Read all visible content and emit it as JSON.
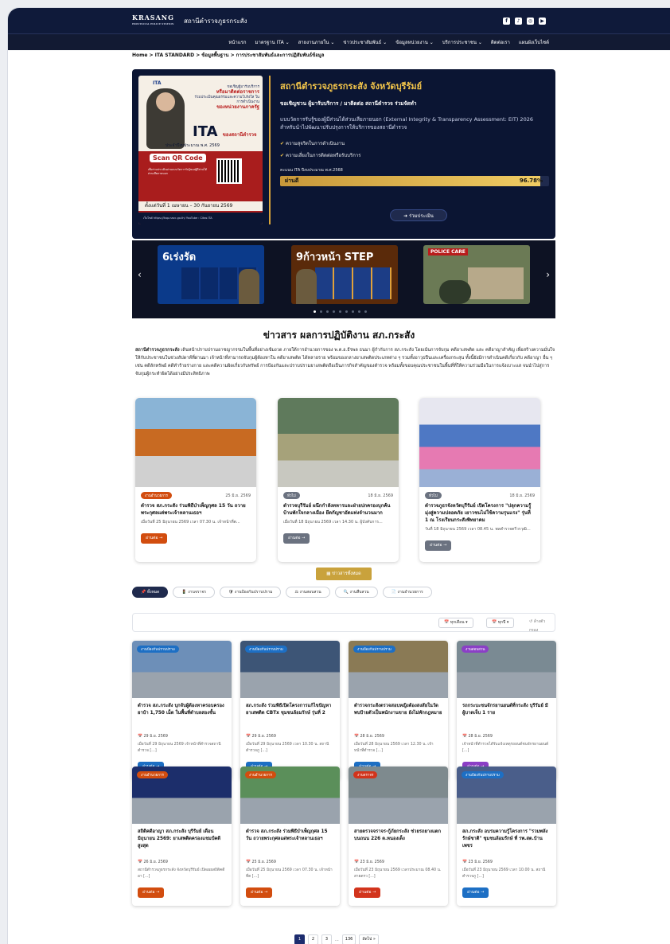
{
  "header": {
    "logo_text": "KRASANG",
    "logo_sub": "PROVINCIAL POLICE STATION",
    "station_name": "สถานีตำรวจภูธรกระสัง",
    "social_icons": [
      "facebook-icon",
      "tiktok-icon",
      "instagram-icon",
      "youtube-icon"
    ]
  },
  "nav": {
    "items": [
      "หน้าแรก",
      "มาตรฐาน ITA ⌄",
      "สายงานภายใน ⌄",
      "ข่าวประชาสัมพันธ์ ⌄",
      "ข้อมูลหน่วยงาน ⌄",
      "บริการประชาชน ⌄",
      "ติดต่อเรา",
      "แผนผังเว็บไซต์"
    ]
  },
  "breadcrumb": "Home > ITA STANDARD > ข้อมูลพื้นฐาน > การประชาสัมพันธ์และการปฏิสัมพันธ์ข้อมูล",
  "hero": {
    "poster": {
      "ita_tag": "ITA",
      "line1": "ขอเชิญผู้มารับบริการ",
      "line2": "หรือมาติดต่อราชการ",
      "line3": "ร่วมประเมินคุณธรรมและความโปร่งใส ในการดำเนินงาน",
      "line4": "ของหน่วยงานภาครัฐ",
      "ita_big": "ITA",
      "ita_of": "ของสถานีตำรวจ",
      "year": "ประจำปีงบประมาณ พ.ศ. 2569",
      "scan": "Scan QR Code",
      "qr_text": "เพื่อร่วมประเมินผ่านแบบวัดการรับรู้ของผู้มีส่วนได้ส่วนเสียภายนอก",
      "dates": "ตั้งแต่วันที่ 1 เมษายน – 30 กันยายน 2569",
      "footer": "เว็บไซต์ https://itap.nacc.go.th/     YouTube : Citas ITA"
    },
    "title": "สถานีตำรวจภูธรกระสัง จังหวัดบุรีรัมย์",
    "subtitle": "ขอเชิญชวน ผู้มารับบริการ / มาติดต่อ สถานีตำรวจ ร่วมจัดทำ",
    "description": "แบบวัดการรับรู้ของผู้มีส่วนได้ส่วนเสียภายนอก (External Integrity & Transparency Assessment: EIT) 2026 สำหรับนำไปพัฒนาปรับปรุงการให้บริการของสถานีตำรวจ",
    "checks": [
      "ความสุจริตในการดำเนินงาน",
      "ความเสี่ยงในการติดต่อหรือรับบริการ"
    ],
    "score_label": "คะแนน ITA ปีงบประมาณ พ.ศ.2568",
    "score_result": "ผ่านดี",
    "score_value": "96.78%",
    "score_fraction": 0.9678,
    "eval_button": "ร่วมประเมิน"
  },
  "slider": {
    "slides": [
      {
        "caption": "6เร่งรัด",
        "bg": "#0b3a8a"
      },
      {
        "caption": "9ก้าวหน้า STEP",
        "bg": "#5a2a0a"
      },
      {
        "caption": "POLICE CARE",
        "bg": "#6b7a55"
      }
    ],
    "dot_count": 9,
    "active_dot": 0
  },
  "section": {
    "title": "ข่าวสาร ผลการปฏิบัติงาน สภ.กระสัง",
    "intro_lead": "สถานีตำรวจภูธรกระสัง",
    "intro": " เดินหน้าปราบปรามอาชญากรรมในพื้นที่อย่างเข้มงวด ภายใต้การอำนวยการของ พ.ต.อ.ธีรพล ธนมา ผู้กำกับการ สภ.กระสัง โดยเน้นการจับกุม คดียาเสพติด และ คดีอาญาสำคัญ เพื่อสร้างความมั่นใจให้กับประชาชนในช่วงสัปดาห์ที่ผ่านมา เจ้าหน้าที่สามารถจับกุมผู้ต้องหาใน คดียาเสพติด ได้หลายราย พร้อมของกลางยาเสพติดประเภทต่าง ๆ รวมทั้งอาวุธปืนและเครื่องกระสุน ทั้งนี้ยังมีการดำเนินคดีเกี่ยวกับ คดีอาญา อื่น ๆ เช่น คดีลักทรัพย์ คดีทำร้ายร่างกาย และคดีความผิดเกี่ยวกับทรัพย์ การป้องกันและปราบปรามยาเสพติดถือเป็นภารกิจสำคัญของตำรวจ พร้อมทั้งขอบคุณประชาชนในพื้นที่ที่ให้ความร่วมมือในการแจ้งเบาะแส จนนำไปสู่การจับกุมผู้กระทำผิดได้อย่างมีประสิทธิภาพ"
  },
  "featured": [
    {
      "tag": "งานอำนวยการ",
      "tag_color": "#d24d0f",
      "date": "25 มิ.ย. 2569",
      "title": "ตำรวจ สภ.กระสัง ร่วมพิธีบำเพ็ญกุศล 15 วัน ถวายพระกุศลแด่พระเจ้าหลานเธอฯ",
      "excerpt": "เมื่อวันที่ 25 มิถุนายน 2569 เวลา 07.30 น. เจ้าหน้าที่ต...",
      "more": "อ่านต่อ →",
      "btn_color": "#d24d0f",
      "photo": "#7aa7c9"
    },
    {
      "tag": "ทั่วไป",
      "tag_color": "#6b7280",
      "date": "18 มิ.ย. 2569",
      "title": "ตำรวจบุรีรัมย์ ผนึกกำลังทหารและฝ่ายปกครองบุกค้นบ้านพักใจกลางเมือง ยึดกัญชาอัดแท่งจำนวนมาก",
      "excerpt": "เมื่อวันที่ 18 มิถุนายน 2569 เวลา 14.30 น. ผู้บังคับการ...",
      "more": "อ่านต่อ →",
      "btn_color": "#6b7280",
      "photo": "#667a63"
    },
    {
      "tag": "ทั่วไป",
      "tag_color": "#6b7280",
      "date": "18 มิ.ย. 2569",
      "title": "ตำรวจภูธรจังหวัดบุรีรัมย์ เปิดโครงการ \"ปลุกความรู้ มุ่งสู่ความปลอดภัย เยาวชนไม่ใช้ความรุนแรง\" รุ่นที่ 1 ณ โรงเรียนกระสังพิทยาคม",
      "excerpt": "วันที่ 18 มิถุนายน 2569 เวลา 08.45 น. พลตำรวจตรีวรวุฒิ...",
      "more": "อ่านต่อ →",
      "btn_color": "#6b7280",
      "photo": "#5b7fc2"
    }
  ],
  "all_news_button": "ข่าวสารทั้งหมด",
  "tabs": [
    {
      "label": "ทั้งหมด",
      "icon": "pin-icon",
      "active": true
    },
    {
      "label": "งานจราจร",
      "icon": "traffic-icon",
      "active": false
    },
    {
      "label": "งานป้องกันปราบปราม",
      "icon": "shield-icon",
      "active": false
    },
    {
      "label": "งานสอบสวน",
      "icon": "scale-icon",
      "active": false
    },
    {
      "label": "งานสืบสวน",
      "icon": "magnifier-icon",
      "active": false
    },
    {
      "label": "งานอำนวยการ",
      "icon": "document-icon",
      "active": false
    }
  ],
  "filters": {
    "month": "ทุกเดือน",
    "year": "ทุกปี",
    "clear": "ล้างตัวกรอง"
  },
  "cards": [
    {
      "tag": "งานป้องกันปราบปราม",
      "tag_color": "#1d6fc4",
      "title": "ตำรวจ สภ.กระสัง บุกจับผู้ต้องหาครอบครองยาบ้า 1,750 เม็ด ในพื้นที่ตำบลสองชั้น",
      "date": "29 มิ.ย. 2569",
      "excerpt": "เมื่อวันที่ 29 มิถุนายน 2569 เจ้าหน้าที่ตำรวจสถานีตำรวจ [...]",
      "more": "อ่านต่อ →",
      "btn_color": "#1d6fc4",
      "photo": "#6d8fb8"
    },
    {
      "tag": "งานป้องกันปราบปราม",
      "tag_color": "#1d6fc4",
      "title": "สภ.กระสัง ร่วมพิธีเปิดโครงการแก้ไขปัญหายาเสพติด CBTx ชุมชนล้อมรักษ์ รุ่นที่ 2",
      "date": "29 มิ.ย. 2569",
      "excerpt": "เมื่อวันที่ 29 มิถุนายน 2569 เวลา 10.30 น. สถานีตำรวจภู [...]",
      "more": "อ่านต่อ →",
      "btn_color": "#1d6fc4",
      "photo": "#3d5576"
    },
    {
      "tag": "งานป้องกันปราบปราม",
      "tag_color": "#1d6fc4",
      "title": "ตำรวจกระสังตรวจสอบหญิงต้องสงสัยในวัด พบป้ายตัวเป็นพนักงานขาย ยังไม่พักกฎหมาย",
      "date": "28 มิ.ย. 2569",
      "excerpt": "เมื่อวันที่ 28 มิถุนายน 2569 เวลา 12.30 น. เจ้าหน้าที่ตำรวจ [...]",
      "more": "อ่านต่อ →",
      "btn_color": "#1d6fc4",
      "photo": "#8a7a55"
    },
    {
      "tag": "งานสอบสวน",
      "tag_color": "#8b3fc6",
      "title": "รถกระบะชนจักรยานยนต์ที่กระสัง บุรีรัมย์ มีผู้บาดเจ็บ 1 ราย",
      "date": "28 มิ.ย. 2569",
      "excerpt": "เจ้าหน้าที่ตำรวจได้รับแจ้งเหตุรถยนต์ชนจักรยานยนต์ [...]",
      "more": "อ่านต่อ →",
      "btn_color": "#8b3fc6",
      "photo": "#7a8a93"
    },
    {
      "tag": "งานอำนวยการ",
      "tag_color": "#d24d0f",
      "title": "สถิติคดีอาญา สภ.กระสัง บุรีรัมย์ เดือนมิถุนายน 2569: ยาเสพติดครองแชมป์คดีสูงสุด",
      "date": "26 มิ.ย. 2569",
      "excerpt": "สถานีตำรวจภูธรกระสัง จังหวัดบุรีรัมย์ เปิดเผยสถิติคดีอา [...]",
      "more": "อ่านต่อ →",
      "btn_color": "#d24d0f",
      "photo": "#1c2e6b"
    },
    {
      "tag": "งานอำนวยการ",
      "tag_color": "#d24d0f",
      "title": "ตำรวจ สภ.กระสัง ร่วมพิธีบำเพ็ญกุศล 15 วัน ถวายพระกุศลแด่พระเจ้าหลานเธอฯ",
      "date": "25 มิ.ย. 2569",
      "excerpt": "เมื่อวันที่ 25 มิถุนายน 2569 เวลา 07.30 น. เจ้าหน้าที่ต [...]",
      "more": "อ่านต่อ →",
      "btn_color": "#d24d0f",
      "photo": "#5b8f5a"
    },
    {
      "tag": "งานจราจร",
      "tag_color": "#d2341c",
      "title": "สายตรวจจราจร-กู้ภัยกระสัง ช่วยรถยางแตกบนถนน 226 ต.หนองเต็ง",
      "date": "23 มิ.ย. 2569",
      "excerpt": "เมื่อวันที่ 23 มิถุนายน 2569 เวลาประมาณ 08.40 น. สายตรว [...]",
      "more": "อ่านต่อ →",
      "btn_color": "#d2341c",
      "photo": "#7e8a8e"
    },
    {
      "tag": "งานป้องกันปราบปราม",
      "tag_color": "#1d6fc4",
      "title": "สภ.กระสัง อบรมความรู้โครงการ \"รวมพลังรักษ์ชาติ\" ชุมชนล้อมรักษ์ ที่ รพ.สต.บ้านเพชร",
      "date": "23 มิ.ย. 2569",
      "excerpt": "เมื่อวันที่ 23 มิถุนายน 2569 เวลา 10.00 น. สถานีตำรวจภู [...]",
      "more": "อ่านต่อ →",
      "btn_color": "#1d6fc4",
      "photo": "#4a5e8a"
    }
  ],
  "pagination": {
    "pages": [
      "1",
      "2",
      "3"
    ],
    "ellipsis": "...",
    "last": "136",
    "next": "ถัดไป »"
  }
}
